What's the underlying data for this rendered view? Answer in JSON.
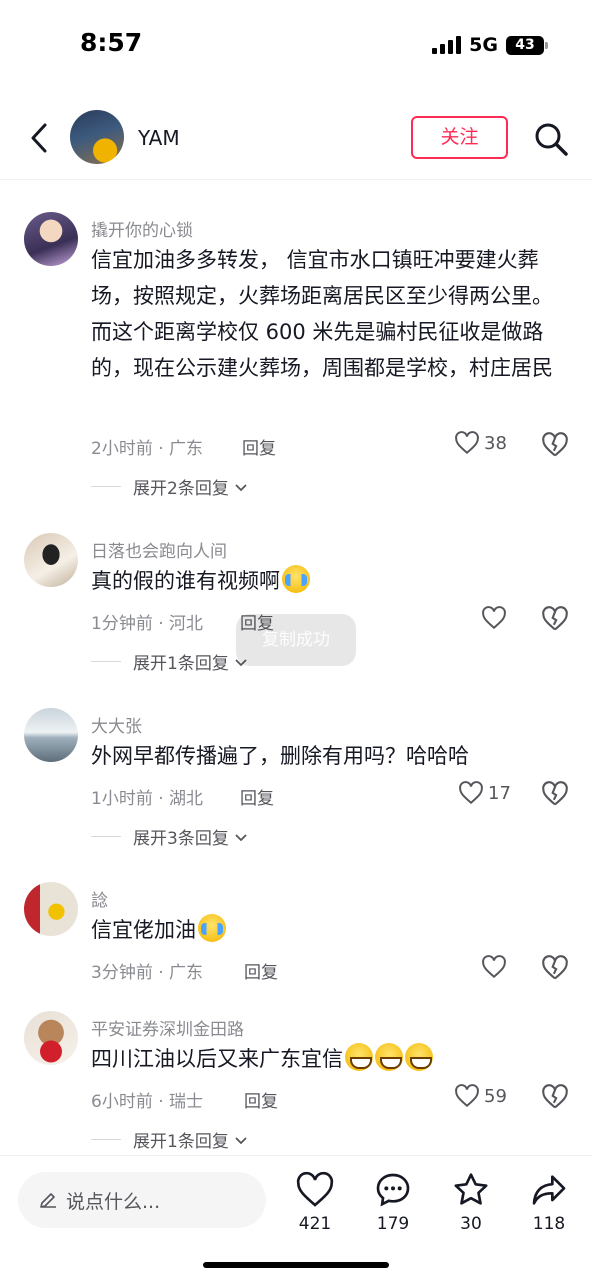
{
  "status_bar": {
    "time": "8:57",
    "network": "5G",
    "battery": "43"
  },
  "header": {
    "username": "YAM",
    "follow_label": "关注"
  },
  "comments": [
    {
      "user": "撬开你的心锁",
      "text": "信宜加油多多转发， 信宜市水口镇旺冲要建火葬场，按照规定，火葬场距离居民区至少得两公里。而这个距离学校仅 600 米先是骗村民征收是做路的，现在公示建火葬场，周围都是学校，村庄居民",
      "time_location": "2小时前 · 广东",
      "reply_label": "回复",
      "likes": "38",
      "expand_label": "展开2条回复"
    },
    {
      "user": "日落也会跑向人间",
      "text": "真的假的谁有视频啊",
      "time_location": "1分钟前 · 河北",
      "reply_label": "回复",
      "likes": "",
      "expand_label": "展开1条回复"
    },
    {
      "user": "大大张",
      "text": "外网早都传播遍了，删除有用吗？哈哈哈",
      "time_location": "1小时前 · 湖北",
      "reply_label": "回复",
      "likes": "17",
      "expand_label": "展开3条回复"
    },
    {
      "user": "諗",
      "text": "信宜佬加油",
      "time_location": "3分钟前 · 广东",
      "reply_label": "回复",
      "likes": "",
      "expand_label": ""
    },
    {
      "user": "平安证券深圳金田路",
      "text": "四川江油以后又来广东宜信",
      "time_location": "6小时前 · 瑞士",
      "reply_label": "回复",
      "likes": "59",
      "expand_label": "展开1条回复"
    }
  ],
  "toast": "复制成功",
  "bottom_bar": {
    "input_placeholder": "说点什么...",
    "likes": "421",
    "comments": "179",
    "favorites": "30",
    "shares": "118"
  },
  "colors": {
    "accent": "#fe2c55",
    "text": "#161823",
    "secondary": "#8a8b91"
  }
}
